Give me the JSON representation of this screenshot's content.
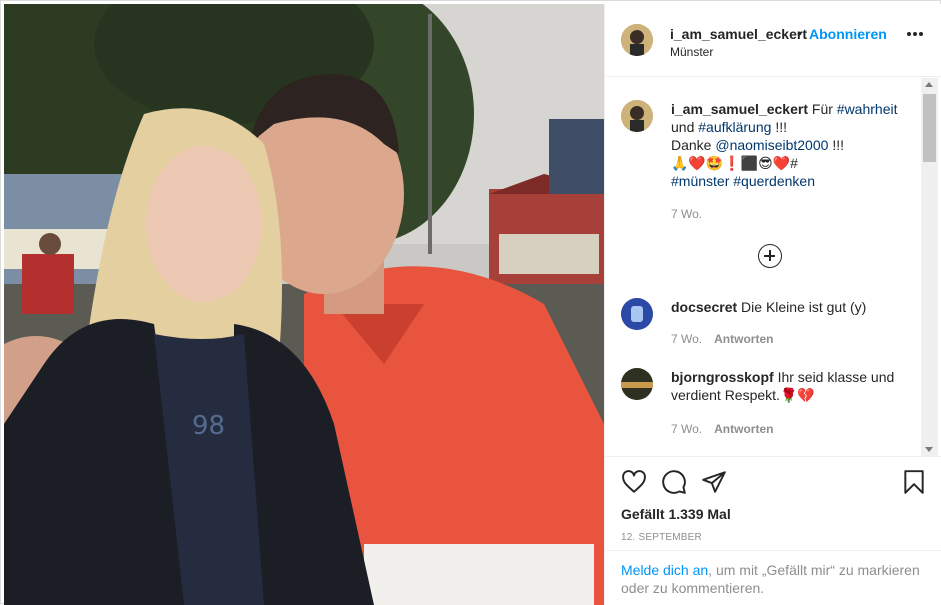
{
  "post": {
    "username": "i_am_samuel_eckert",
    "separator": "•",
    "follow_label": "Abonnieren",
    "location": "Münster",
    "caption": {
      "username": "i_am_samuel_eckert",
      "prefix": "Für",
      "tag1": "#wahrheit",
      "and": "und",
      "tag2": "#aufklärung",
      "exclaim": "!!!",
      "thanks": "Danke",
      "mention": "@naomiseibt2000",
      "exclaim2": "!!!",
      "emojis": "🙏❤️🤩❗⬛😎❤️#",
      "tag3": "#münster",
      "tag4": "#querdenken",
      "age": "7 Wo."
    },
    "comments": [
      {
        "username": "docsecret",
        "text": "Die Kleine ist gut (y)",
        "age": "7 Wo.",
        "reply": "Antworten"
      },
      {
        "username": "bjorngrosskopf",
        "text": "Ihr seid klasse und verdient Respekt.🌹💔",
        "age": "7 Wo.",
        "reply": "Antworten"
      }
    ],
    "likes": "Gefällt 1.339 Mal",
    "date": "12. SEPTEMBER",
    "login": {
      "link": "Melde dich an",
      "rest": ", um mit „Gefällt mir“ zu markieren oder zu kommentieren."
    }
  },
  "icons": {
    "more": "more-horizontal-icon",
    "load_more": "plus-circle-icon",
    "like": "heart-icon",
    "comment": "comment-bubble-icon",
    "share": "paper-plane-icon",
    "save": "bookmark-icon"
  },
  "colors": {
    "accent": "#0095f6",
    "mention": "#00376b",
    "muted": "#8e8e8e",
    "text": "#262626"
  }
}
